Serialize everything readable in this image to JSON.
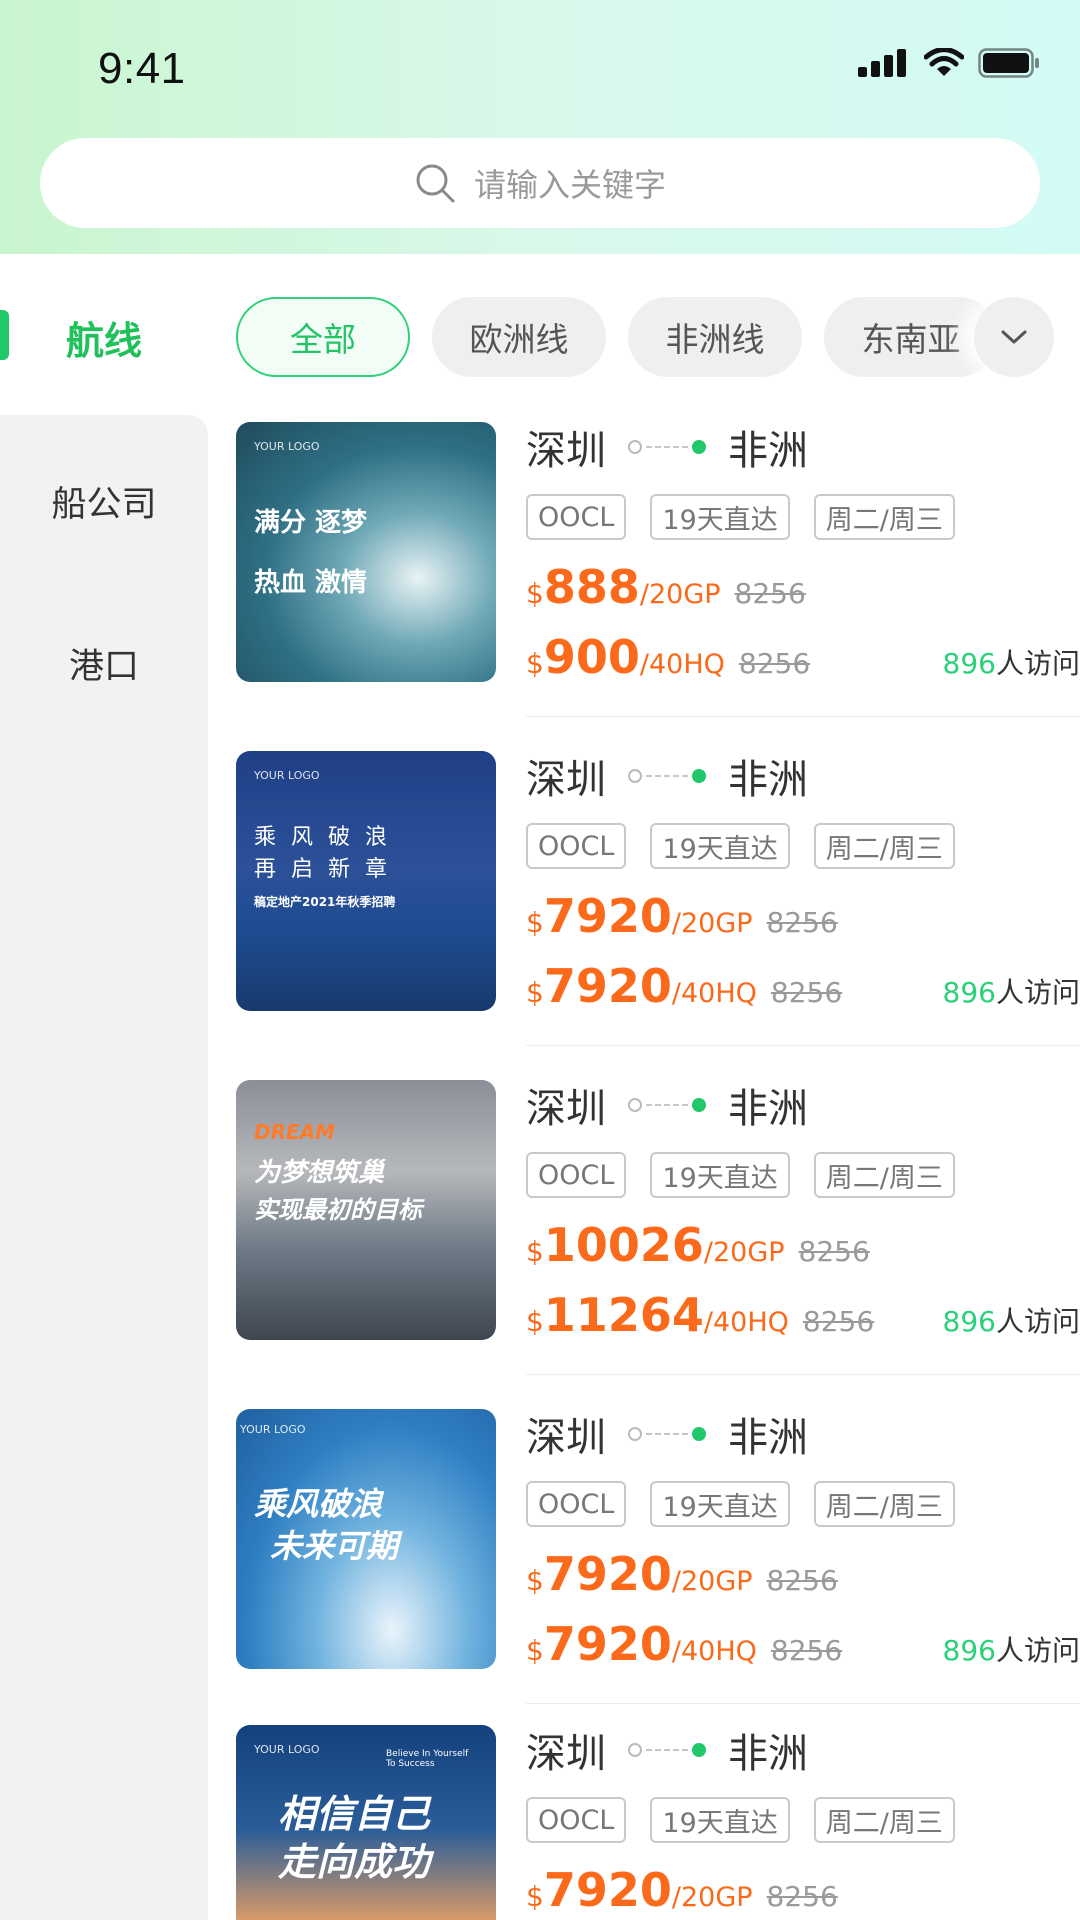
{
  "status_bar": {
    "time": "9:41",
    "icons": [
      "signal-icon",
      "wifi-icon",
      "battery-icon"
    ]
  },
  "search": {
    "placeholder": "请输入关键字",
    "icon": "search-icon"
  },
  "sidebar": {
    "active": "航线",
    "items": [
      "船公司",
      "港口"
    ]
  },
  "filters": {
    "chips": [
      "全部",
      "欧洲线",
      "非洲线",
      "东南亚"
    ],
    "active_index": 0,
    "more_icon": "chevron-down-icon"
  },
  "colors": {
    "accent_green": "#20c86a",
    "price_orange": "#fa6a1a"
  },
  "listings": [
    {
      "from": "深圳",
      "to": "非洲",
      "tags": [
        "OOCL",
        "19天直达",
        "周二/周三"
      ],
      "prices": [
        {
          "currency": "$",
          "value": "888",
          "unit": "/20GP",
          "old": "8256"
        },
        {
          "currency": "$",
          "value": "900",
          "unit": "/40HQ",
          "old": "8256"
        }
      ],
      "visits": "896",
      "visits_suffix": "人访问",
      "image_text": [
        "满分 逐梦",
        "热血 激情"
      ],
      "image_logo": "YOUR LOGO"
    },
    {
      "from": "深圳",
      "to": "非洲",
      "tags": [
        "OOCL",
        "19天直达",
        "周二/周三"
      ],
      "prices": [
        {
          "currency": "$",
          "value": "7920",
          "unit": "/20GP",
          "old": "8256"
        },
        {
          "currency": "$",
          "value": "7920",
          "unit": "/40HQ",
          "old": "8256"
        }
      ],
      "visits": "896",
      "visits_suffix": "人访问",
      "image_text": [
        "乘 风 破 浪",
        "再 启 新 章",
        "稿定地产2021年秋季招聘"
      ],
      "image_logo": "YOUR LOGO"
    },
    {
      "from": "深圳",
      "to": "非洲",
      "tags": [
        "OOCL",
        "19天直达",
        "周二/周三"
      ],
      "prices": [
        {
          "currency": "$",
          "value": "10026",
          "unit": "/20GP",
          "old": "8256"
        },
        {
          "currency": "$",
          "value": "11264",
          "unit": "/40HQ",
          "old": "8256"
        }
      ],
      "visits": "896",
      "visits_suffix": "人访问",
      "image_text": [
        "DREAM",
        "为梦想筑巢",
        "实现最初的目标"
      ],
      "image_logo": ""
    },
    {
      "from": "深圳",
      "to": "非洲",
      "tags": [
        "OOCL",
        "19天直达",
        "周二/周三"
      ],
      "prices": [
        {
          "currency": "$",
          "value": "7920",
          "unit": "/20GP",
          "old": "8256"
        },
        {
          "currency": "$",
          "value": "7920",
          "unit": "/40HQ",
          "old": "8256"
        }
      ],
      "visits": "896",
      "visits_suffix": "人访问",
      "image_text": [
        "乘风破浪",
        "未来可期"
      ],
      "image_logo": "YOUR LOGO"
    },
    {
      "from": "深圳",
      "to": "非洲",
      "tags": [
        "OOCL",
        "19天直达",
        "周二/周三"
      ],
      "prices": [
        {
          "currency": "$",
          "value": "7920",
          "unit": "/20GP",
          "old": "8256"
        }
      ],
      "visits": "",
      "visits_suffix": "",
      "image_text": [
        "Believe In Yourself To Success",
        "相信自己",
        "走向成功"
      ],
      "image_logo": "YOUR LOGO"
    }
  ]
}
